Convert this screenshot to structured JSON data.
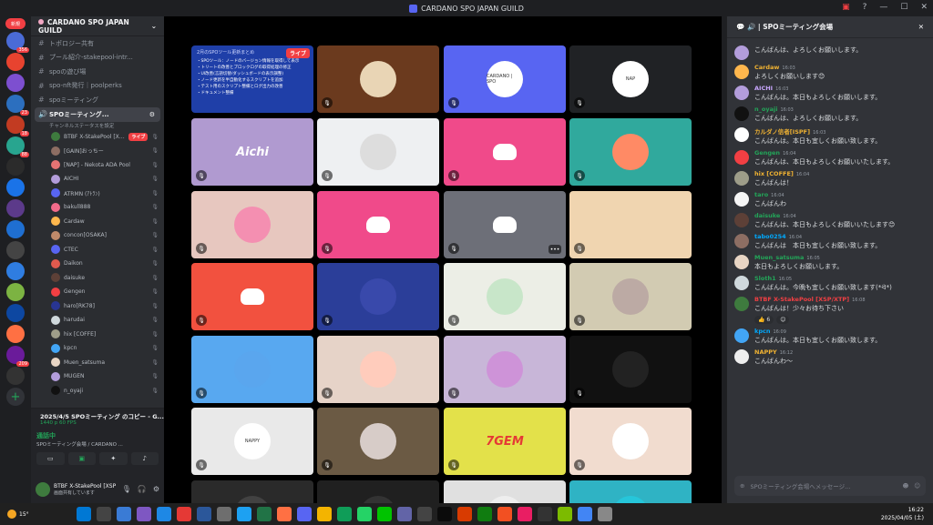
{
  "window": {
    "title": "CARDANO SPO JAPAN GUILD"
  },
  "rail": {
    "new_badge": "新規",
    "servers": [
      {
        "color": "#4a6bd6",
        "badge": "356"
      },
      {
        "color": "#e8432f",
        "badge": ""
      },
      {
        "color": "#7d4fd0",
        "badge": ""
      },
      {
        "color": "#2c6fbf",
        "badge": "23"
      },
      {
        "color": "#c23b22",
        "badge": "18"
      },
      {
        "color": "#28a58f",
        "badge": "88"
      },
      {
        "color": "#2b2b2b",
        "badge": ""
      },
      {
        "color": "#1a73e8",
        "badge": ""
      },
      {
        "color": "#5c3a8a",
        "badge": ""
      },
      {
        "color": "#1f6fd1",
        "badge": ""
      },
      {
        "color": "#444",
        "badge": ""
      },
      {
        "color": "#2f7de1",
        "badge": ""
      },
      {
        "color": "#7cb342",
        "badge": ""
      },
      {
        "color": "#0d47a1",
        "badge": ""
      },
      {
        "color": "#ff7043",
        "badge": ""
      },
      {
        "color": "#6a1b9a",
        "badge": "209"
      },
      {
        "color": "#333",
        "badge": ""
      }
    ]
  },
  "sidebar": {
    "server_name": "CARDANO SPO JAPAN GUILD",
    "channels": [
      {
        "icon": "#",
        "label": "トポロジー共有"
      },
      {
        "icon": "#",
        "label": "プール紹介-stakepool-intr..."
      },
      {
        "icon": "#",
        "label": "spoの遊び場"
      },
      {
        "icon": "#",
        "label": "spo-nft発行｜poolperks"
      },
      {
        "icon": "#",
        "label": "spoミーティング"
      }
    ],
    "active_voice": {
      "label": "SPOミーティング...",
      "status": "チャンネルステータスを設定"
    },
    "members": [
      {
        "name": "BTBF X-StakePool [XS...",
        "color": "#3e7b3e",
        "live": "ライブ"
      },
      {
        "name": "[GAIN]おっちー",
        "color": "#8d6e63",
        "live": ""
      },
      {
        "name": "[NAP] - Nekota ADA Pool",
        "color": "#e57373",
        "live": ""
      },
      {
        "name": "AICHI",
        "color": "#b39ddb",
        "live": ""
      },
      {
        "name": "ATRMN (ｱﾄﾗﾝ)",
        "color": "#5865f2",
        "live": ""
      },
      {
        "name": "bakull888",
        "color": "#f26b8a",
        "live": ""
      },
      {
        "name": "Cardaw",
        "color": "#ffb74d",
        "live": ""
      },
      {
        "name": "concon[OSAKA]",
        "color": "#c08a6a",
        "live": ""
      },
      {
        "name": "CTEC",
        "color": "#5865f2",
        "live": ""
      },
      {
        "name": "Daikon",
        "color": "#e05a4e",
        "live": ""
      },
      {
        "name": "daisuke",
        "color": "#5d4037",
        "live": ""
      },
      {
        "name": "Gengen",
        "color": "#f23f43",
        "live": ""
      },
      {
        "name": "haro[RK78]",
        "color": "#283593",
        "live": ""
      },
      {
        "name": "harudai",
        "color": "#cfd8dc",
        "live": ""
      },
      {
        "name": "hix [COFFE]",
        "color": "#9e9d89",
        "live": ""
      },
      {
        "name": "kpcn",
        "color": "#42a5f5",
        "live": ""
      },
      {
        "name": "Muen_satsuma",
        "color": "#e8d5c4",
        "live": ""
      },
      {
        "name": "MUGEN",
        "color": "#b39ddb",
        "live": ""
      },
      {
        "name": "n_oyaji",
        "color": "#111",
        "live": ""
      }
    ]
  },
  "voice_panel": {
    "title": "2025/4/5 SPOミーティング のコピー - G...",
    "fps": "1440 p 60 FPS",
    "status": "通話中",
    "channel": "SPOミーティング会場 / CARDANO ..."
  },
  "user_panel": {
    "name": "BTBF X-StakePool [XSP/XS...",
    "status": "画面共有しています"
  },
  "stage": {
    "slide": {
      "header": "2月のSPOツール更新まとめ",
      "lines": [
        "・SPOツール：ノードのバージョン情報を取得して表示",
        "・トリートの改善とブロックログの取得処理の修正",
        "・UI改善(言語切替/ダッシュボードの表示調整)",
        "・ノード更新を半自動化するスクリプトを追加",
        "・テスト用のスクリプト整備とログ出力の改善",
        "・ドキュメント整備"
      ],
      "live": "ライブ"
    },
    "tiles": [
      {
        "bg": "#6b3a1e",
        "type": "avatar",
        "avbg": "#e9d5b5",
        "label": ""
      },
      {
        "bg": "#5865f2",
        "type": "avatar",
        "avbg": "#ffffff",
        "label": "CARDANO | SPO"
      },
      {
        "bg": "#202225",
        "type": "avatar",
        "avbg": "#ffffff",
        "label": "NAP"
      },
      {
        "bg": "#b09ad0",
        "type": "text",
        "avbg": "",
        "label": "Aichi"
      },
      {
        "bg": "#eef0f2",
        "type": "avatar",
        "avbg": "#dddddd",
        "label": ""
      },
      {
        "bg": "#f04a8a",
        "type": "discord",
        "avbg": "",
        "label": ""
      },
      {
        "bg": "#30a99d",
        "type": "avatar",
        "avbg": "#ff8a65",
        "label": ""
      },
      {
        "bg": "#e7c7bf",
        "type": "avatar",
        "avbg": "#f48fb1",
        "label": ""
      },
      {
        "bg": "#f04a8a",
        "type": "discord",
        "avbg": "",
        "label": ""
      },
      {
        "bg": "#6d6f78",
        "type": "discord",
        "avbg": "",
        "label": ""
      },
      {
        "bg": "#f0d5b0",
        "type": "avatar",
        "avbg": "#f0d5b0",
        "label": ""
      },
      {
        "bg": "#f2513f",
        "type": "discord",
        "avbg": "",
        "label": ""
      },
      {
        "bg": "#2b3e99",
        "type": "avatar",
        "avbg": "#3949ab",
        "label": ""
      },
      {
        "bg": "#eceee6",
        "type": "avatar",
        "avbg": "#c8e6c9",
        "label": ""
      },
      {
        "bg": "#d2cbb2",
        "type": "avatar",
        "avbg": "#bcaaa4",
        "label": ""
      },
      {
        "bg": "#58a8f0",
        "type": "avatar",
        "avbg": "#5aa6ee",
        "label": ""
      },
      {
        "bg": "#e6d3c8",
        "type": "avatar",
        "avbg": "#ffccbc",
        "label": ""
      },
      {
        "bg": "#c8b6d8",
        "type": "avatar",
        "avbg": "#ce93d8",
        "label": ""
      },
      {
        "bg": "#111111",
        "type": "avatar",
        "avbg": "#222222",
        "label": ""
      },
      {
        "bg": "#e9e9e9",
        "type": "avatar",
        "avbg": "#ffffff",
        "label": "NAPPY"
      },
      {
        "bg": "#6b5a44",
        "type": "avatar",
        "avbg": "#d7ccc8",
        "label": ""
      },
      {
        "bg": "#e3e14a",
        "type": "text",
        "avbg": "",
        "label": "7GEM"
      },
      {
        "bg": "#f1dccf",
        "type": "avatar",
        "avbg": "#ffffff",
        "label": ""
      },
      {
        "bg": "#2a2a2a",
        "type": "avatar",
        "avbg": "#424242",
        "label": ""
      },
      {
        "bg": "#202020",
        "type": "avatar",
        "avbg": "#333333",
        "label": ""
      },
      {
        "bg": "#e0e0e0",
        "type": "avatar",
        "avbg": "#eeeeee",
        "label": ""
      },
      {
        "bg": "#2fb3c4",
        "type": "avatar",
        "avbg": "#26c6da",
        "label": ""
      }
    ]
  },
  "chat": {
    "channel": "SPOミーティング会場",
    "placeholder": "SPOミーティング会場へメッセージ...",
    "messages": [
      {
        "name": "",
        "time": "",
        "text": "こんばんは、よろしくお願いします。",
        "color": "#dbdee1",
        "av": "#b39ddb"
      },
      {
        "name": "Cardaw",
        "time": "16:03",
        "text": "よろしくお願いします😊",
        "color": "#f0b232",
        "av": "#ffb74d"
      },
      {
        "name": "AICHI",
        "time": "16:03",
        "text": "こんばんは。本日もよろしくお願いします。",
        "color": "#c9a7ff",
        "av": "#b39ddb"
      },
      {
        "name": "n_oyaji",
        "time": "16:03",
        "text": "こんばんは、よろしくお願いします。",
        "color": "#23a559",
        "av": "#111"
      },
      {
        "name": "カルダノ信者[ISPF]",
        "time": "16:03",
        "text": "こんばんは。本日も宜しくお願い致します。",
        "color": "#f0b232",
        "av": "#ffffff"
      },
      {
        "name": "Gengen",
        "time": "16:04",
        "text": "こんばんは、本日もよろしくお願いいたします。",
        "color": "#23a559",
        "av": "#f23f43"
      },
      {
        "name": "hix [COFFE]",
        "time": "16:04",
        "text": "こんばんは！",
        "color": "#f0b232",
        "av": "#9e9d89"
      },
      {
        "name": "taro",
        "time": "16:04",
        "text": "こんばんわ",
        "color": "#23a559",
        "av": "#f5f5f5"
      },
      {
        "name": "daisuke",
        "time": "16:04",
        "text": "こんばんは、本日もよろしくお願いいたします😊",
        "color": "#23a559",
        "av": "#5d4037"
      },
      {
        "name": "tabo0254",
        "time": "16:04",
        "text": "こんばんは　本日も宜しくお願い致します。",
        "color": "#00a8fc",
        "av": "#8d6e63"
      },
      {
        "name": "Muen_satsuma",
        "time": "16:05",
        "text": "本日もよろしくお願いします。",
        "color": "#23a559",
        "av": "#e8d5c4"
      },
      {
        "name": "Sloth1",
        "time": "16:05",
        "text": "こんばんは。今晩も宜しくお願い致します(*ᐛ*)",
        "color": "#23a559",
        "av": "#cfd8dc"
      },
      {
        "name": "BTBF X-StakePool [XSP/XTP]",
        "time": "16:08",
        "text": "こんばんは！少々お待ち下さい",
        "color": "#f23f43",
        "av": "#3e7b3e"
      },
      {
        "name": "kpcn",
        "time": "16:09",
        "text": "こんばんは。本日も宜しくお願い致します。",
        "color": "#00a8fc",
        "av": "#42a5f5"
      },
      {
        "name": "NAPPY",
        "time": "16:12",
        "text": "こんばんわ〜",
        "color": "#f0b232",
        "av": "#eeeeee"
      }
    ],
    "reactions": [
      {
        "e": "👍",
        "n": "6"
      },
      {
        "e": "😊",
        "n": ""
      }
    ]
  },
  "taskbar": {
    "weather": "15°",
    "time": "16:22",
    "date": "2025/04/05 (土)"
  }
}
